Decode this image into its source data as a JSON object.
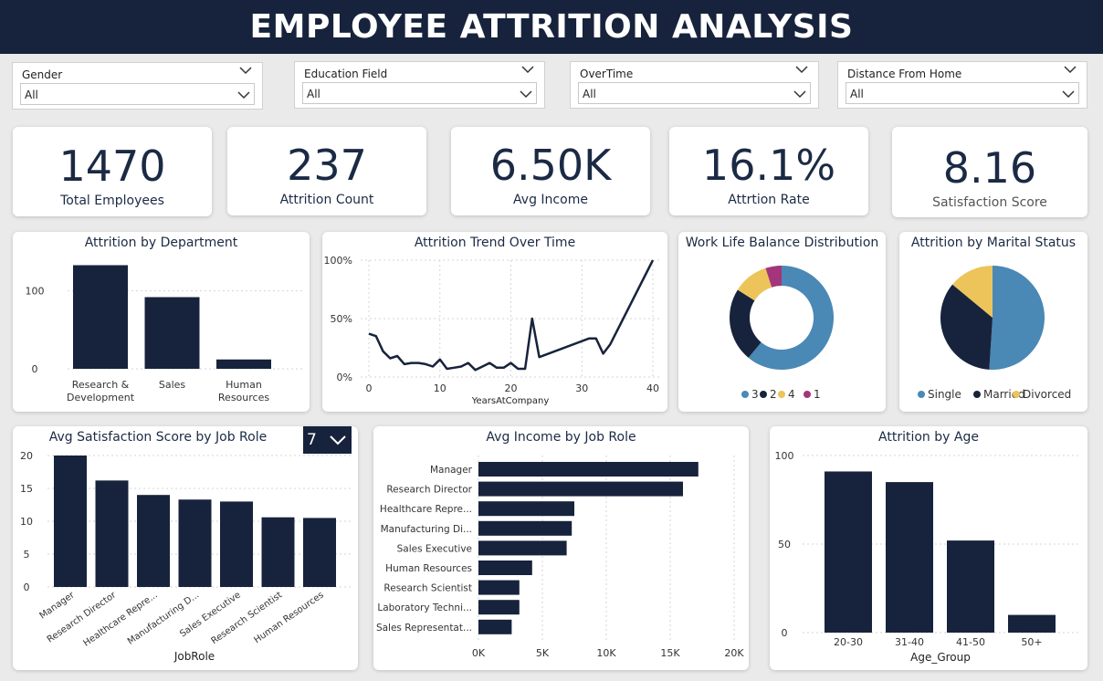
{
  "header": {
    "title": "EMPLOYEE ATTRITION ANALYSIS"
  },
  "slicers": [
    {
      "label": "Gender",
      "value": "All"
    },
    {
      "label": "Education Field",
      "value": "All"
    },
    {
      "label": "OverTime",
      "value": "All"
    },
    {
      "label": "Distance From Home",
      "value": "All"
    }
  ],
  "kpis": [
    {
      "value": "1470",
      "label": "Total Employees"
    },
    {
      "value": "237",
      "label": "Attrition Count"
    },
    {
      "value": "6.50K",
      "label": "Avg Income"
    },
    {
      "value": "16.1%",
      "label": "Attrtion Rate"
    },
    {
      "value": "8.16",
      "label": "Satisfaction Score"
    }
  ],
  "colors": {
    "navy": "#17233c",
    "blue": "#4a88b5",
    "yellow": "#ecc45a",
    "magenta": "#a3357a"
  },
  "topn_selector": {
    "value": "7",
    "icon": "chevron-down-icon"
  },
  "chart_data": [
    {
      "type": "bar",
      "title": "Attrition by Department",
      "categories": [
        "Research & Development",
        "Sales",
        "Human Resources"
      ],
      "category_lines": [
        [
          "Research &",
          "Development"
        ],
        [
          "Sales"
        ],
        [
          "Human",
          "Resources"
        ]
      ],
      "values": [
        133,
        92,
        12
      ],
      "ylim": [
        0,
        150
      ],
      "yticks": [
        "0",
        "100"
      ],
      "xlabel": "",
      "ylabel": ""
    },
    {
      "type": "line",
      "title": "Attrition Trend Over Time",
      "xlabel": "YearsAtCompany",
      "ylabel": "",
      "x": [
        0,
        1,
        2,
        3,
        4,
        5,
        6,
        7,
        8,
        9,
        10,
        11,
        12,
        13,
        14,
        15,
        16,
        17,
        18,
        19,
        20,
        21,
        22,
        23,
        24,
        31,
        32,
        33,
        34,
        40
      ],
      "y": [
        37,
        35,
        22,
        16,
        18,
        11,
        12,
        12,
        11,
        9,
        15,
        7,
        8,
        9,
        12,
        6,
        9,
        12,
        8,
        8,
        12,
        7,
        7,
        50,
        17,
        33,
        33,
        20,
        28,
        100
      ],
      "ylim": [
        0,
        100
      ],
      "xlim": [
        0,
        40
      ],
      "yticks": [
        "0%",
        "50%",
        "100%"
      ],
      "xticks": [
        "0",
        "10",
        "20",
        "30",
        "40"
      ]
    },
    {
      "type": "pie",
      "donut": true,
      "title": "Work Life Balance Distribution",
      "labels": [
        "3",
        "2",
        "4",
        "1"
      ],
      "values": [
        61,
        23,
        11,
        5
      ]
    },
    {
      "type": "pie",
      "donut": false,
      "title": "Attrition by Marital Status",
      "labels": [
        "Single",
        "Married",
        "Divorced"
      ],
      "values": [
        51,
        35,
        14
      ]
    },
    {
      "type": "bar",
      "title": "Avg Satisfaction Score by Job Role",
      "xlabel": "JobRole",
      "ylabel": "",
      "categories": [
        "Manager",
        "Research Director",
        "Healthcare Repre...",
        "Manufacturing D...",
        "Sales Executive",
        "Research Scientist",
        "Human Resources"
      ],
      "values": [
        20,
        16.2,
        14,
        13.3,
        13,
        10.6,
        10.5
      ],
      "ylim": [
        0,
        20
      ],
      "yticks": [
        "0",
        "5",
        "10",
        "15",
        "20"
      ]
    },
    {
      "type": "bar",
      "orientation": "horizontal",
      "title": "Avg Income by Job Role",
      "categories": [
        "Manager",
        "Research Director",
        "Healthcare Repre...",
        "Manufacturing Di...",
        "Sales Executive",
        "Human Resources",
        "Research Scientist",
        "Laboratory Techni...",
        "Sales Representat..."
      ],
      "values": [
        17200,
        16000,
        7500,
        7300,
        6900,
        4200,
        3200,
        3200,
        2600
      ],
      "xlim": [
        0,
        20000
      ],
      "xticks": [
        "0K",
        "5K",
        "10K",
        "15K",
        "20K"
      ]
    },
    {
      "type": "bar",
      "title": "Attrition by Age",
      "xlabel": "Age_Group",
      "ylabel": "",
      "categories": [
        "20-30",
        "31-40",
        "41-50",
        "50+"
      ],
      "values": [
        91,
        85,
        52,
        10
      ],
      "ylim": [
        0,
        100
      ],
      "yticks": [
        "0",
        "50",
        "100"
      ]
    }
  ]
}
